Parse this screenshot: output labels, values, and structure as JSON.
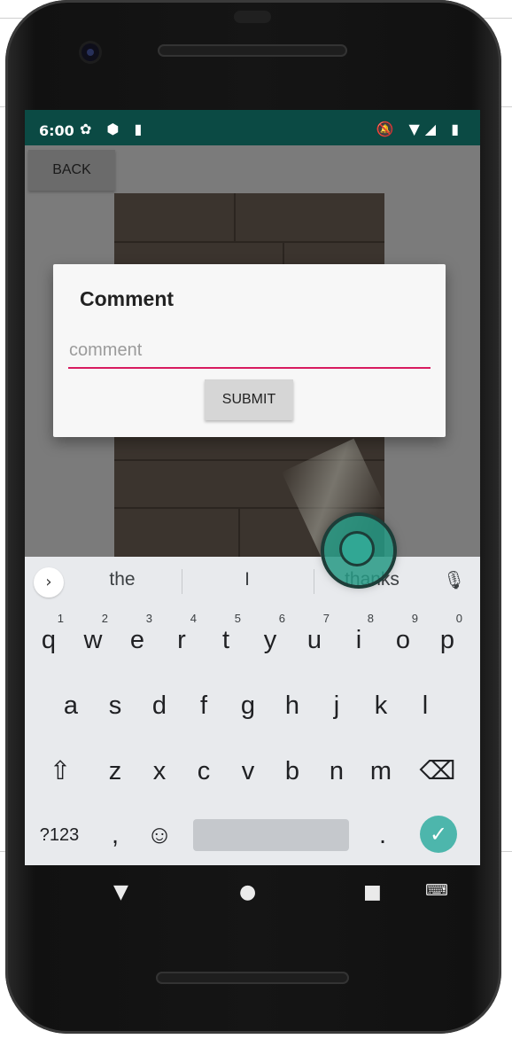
{
  "status_bar": {
    "time": "6:00",
    "left_icons": "✿ ⬢ ▮",
    "right_icons": "🔕 ▼◢ ▮"
  },
  "app": {
    "back_label": "BACK"
  },
  "dialog": {
    "title": "Comment",
    "input_placeholder": "comment",
    "input_value": "",
    "submit_label": "SUBMIT"
  },
  "keyboard": {
    "suggestions": [
      "the",
      "I",
      "thanks"
    ],
    "expand_icon": "›",
    "mic_icon": "mic-icon",
    "row1": [
      {
        "key": "q",
        "hint": "1"
      },
      {
        "key": "w",
        "hint": "2"
      },
      {
        "key": "e",
        "hint": "3"
      },
      {
        "key": "r",
        "hint": "4"
      },
      {
        "key": "t",
        "hint": "5"
      },
      {
        "key": "y",
        "hint": "6"
      },
      {
        "key": "u",
        "hint": "7"
      },
      {
        "key": "i",
        "hint": "8"
      },
      {
        "key": "o",
        "hint": "9"
      },
      {
        "key": "p",
        "hint": "0"
      }
    ],
    "row2": [
      "a",
      "s",
      "d",
      "f",
      "g",
      "h",
      "j",
      "k",
      "l"
    ],
    "row3": [
      "z",
      "x",
      "c",
      "v",
      "b",
      "n",
      "m"
    ],
    "shift_icon": "⇧",
    "backspace_icon": "⌫",
    "symbols_label": "?123",
    "comma_label": ",",
    "emoji_icon": "☺",
    "period_label": ".",
    "enter_icon": "✓",
    "enter_color": "#4db6ac"
  },
  "nav_bar": {
    "back_icon": "▼",
    "home_icon": "●",
    "recents_icon": "■",
    "keyboard_switch_icon": "⌨"
  },
  "colors": {
    "status_bar": "#0b4a44",
    "accent_underline": "#d81b60"
  }
}
